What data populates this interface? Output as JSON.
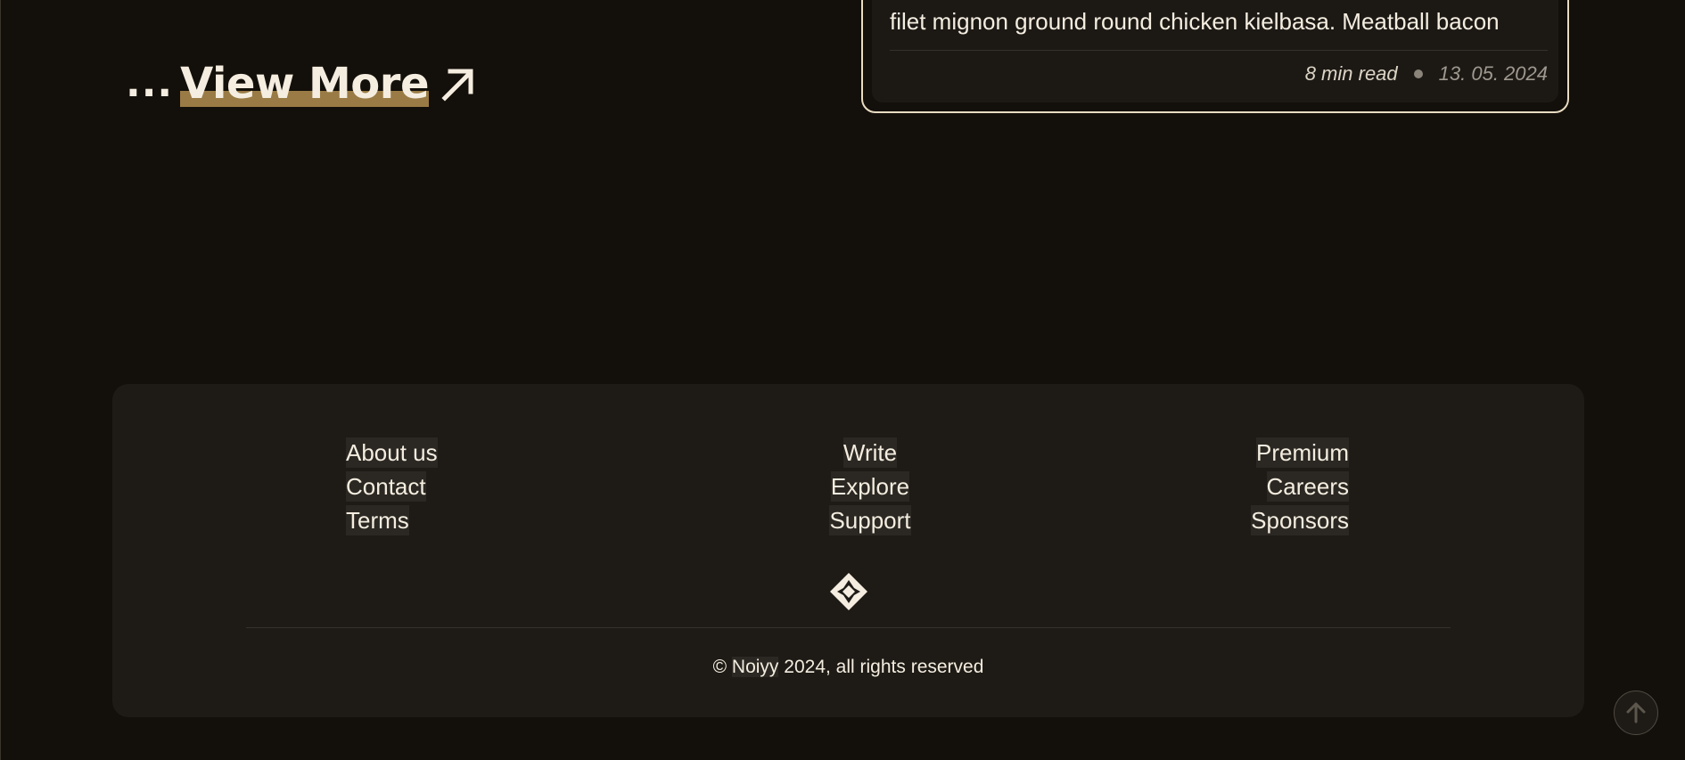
{
  "view_more": {
    "dots": "...",
    "label": "View More",
    "icon": "arrow-up-right-icon"
  },
  "article_card": {
    "excerpt": "filet mignon ground round chicken kielbasa. Meatball bacon",
    "read_time": "8 min read",
    "date": "13. 05. 2024"
  },
  "footer": {
    "columns": [
      [
        "About us",
        "Contact",
        "Terms"
      ],
      [
        "Write",
        "Explore",
        "Support"
      ],
      [
        "Premium",
        "Careers",
        "Sponsors"
      ]
    ],
    "logo_icon": "diamond-logo-icon",
    "copyright_symbol": "©",
    "brand": "Noiyy",
    "copyright_rest": "2024, all rights reserved"
  },
  "scroll_top": {
    "icon": "arrow-up-circle-icon"
  },
  "colors": {
    "background": "#130f0a",
    "footer_bg": "#1e1b16",
    "text": "#f4ede0",
    "accent": "#9a7b45"
  }
}
